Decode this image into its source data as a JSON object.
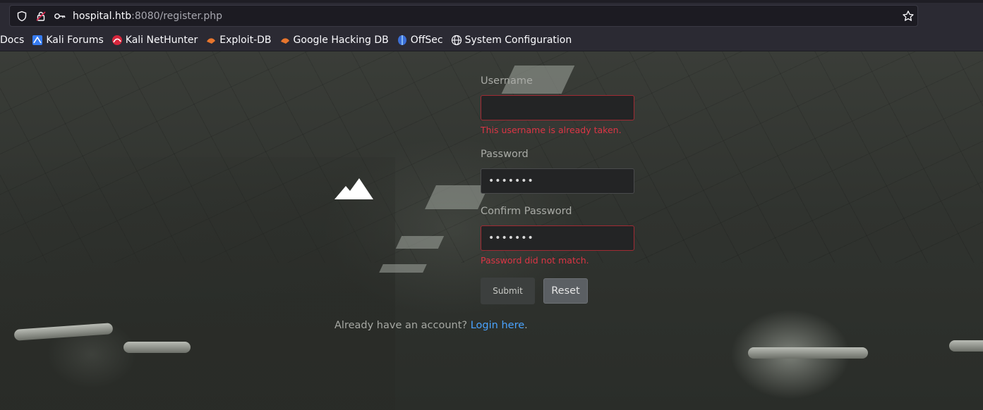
{
  "browser": {
    "url_host": "hospital.htb",
    "url_rest": ":8080/register.php",
    "bookmarks": [
      {
        "label": "Docs",
        "icon": "docs-icon"
      },
      {
        "label": "Kali Forums",
        "icon": "kali-forums-icon"
      },
      {
        "label": "Kali NetHunter",
        "icon": "kali-nethunter-icon"
      },
      {
        "label": "Exploit-DB",
        "icon": "exploit-db-icon"
      },
      {
        "label": "Google Hacking DB",
        "icon": "ghdb-icon"
      },
      {
        "label": "OffSec",
        "icon": "offsec-icon"
      },
      {
        "label": "System Configuration",
        "icon": "globe-icon"
      }
    ]
  },
  "form": {
    "username_label": "Username",
    "username_value": "",
    "username_error": "This username is already taken.",
    "password_label": "Password",
    "password_value": "•••••••",
    "confirm_label": "Confirm Password",
    "confirm_value": "•••••••",
    "confirm_error": "Password did not match.",
    "submit_label": "Submit",
    "reset_label": "Reset"
  },
  "footer": {
    "prompt": "Already have an account? ",
    "link": "Login here",
    "suffix": "."
  },
  "colors": {
    "error": "#dc3545",
    "link": "#4aa3ff",
    "toolbar": "#2b2a33"
  }
}
